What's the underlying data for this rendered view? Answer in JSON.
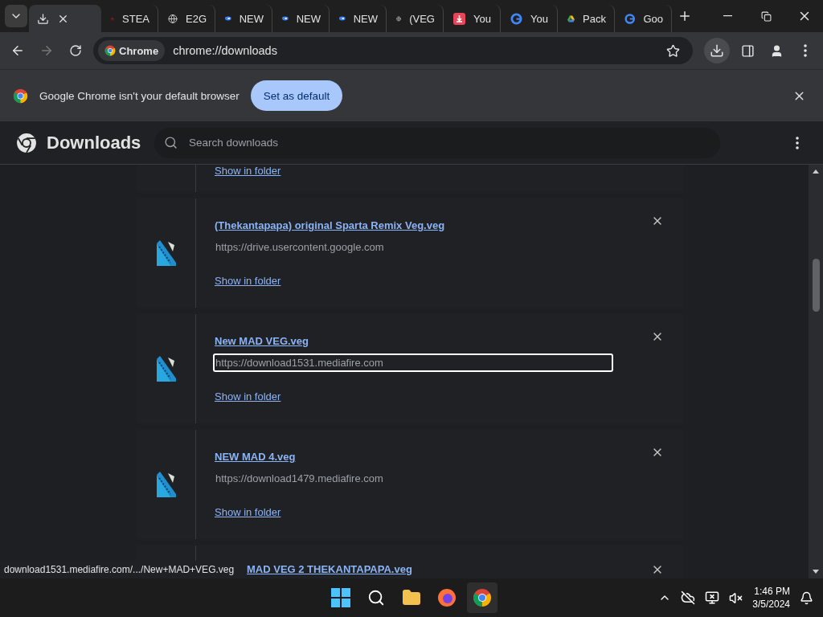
{
  "tabs": [
    {
      "selected": true
    },
    {
      "title": "STEA",
      "selected": false
    },
    {
      "title": "E2G",
      "selected": false
    },
    {
      "title": "NEW",
      "selected": false
    },
    {
      "title": "NEW",
      "selected": false
    },
    {
      "title": "NEW",
      "selected": false
    },
    {
      "title": "(VEG",
      "selected": false
    },
    {
      "title": "You",
      "selected": false
    },
    {
      "title": "You",
      "selected": false
    },
    {
      "title": "Pack",
      "selected": false
    },
    {
      "title": "Goo",
      "selected": false
    }
  ],
  "toolbar": {
    "chip": "Chrome",
    "url": "chrome://downloads"
  },
  "infobar": {
    "message": "Google Chrome isn't your default browser",
    "button": "Set as default"
  },
  "header": {
    "title": "Downloads",
    "search_placeholder": "Search downloads"
  },
  "downloads": [
    {
      "kind": "tail",
      "link": "Show in folder"
    },
    {
      "kind": "full",
      "name": "(Thekantapapa) original Sparta Remix Veg.veg",
      "url": "https://drive.usercontent.google.com",
      "link": "Show in folder",
      "focused": false
    },
    {
      "kind": "full",
      "name": "New MAD VEG.veg",
      "url": "https://download1531.mediafire.com",
      "link": "Show in folder",
      "focused": true
    },
    {
      "kind": "full",
      "name": "NEW MAD 4.veg",
      "url": "https://download1479.mediafire.com",
      "link": "Show in folder",
      "focused": false
    },
    {
      "kind": "head",
      "name": "MAD VEG 2 THEKANTAPAPA.veg"
    }
  ],
  "status_bubble": "download1531.mediafire.com/.../New+MAD+VEG.veg",
  "taskbar": {
    "time": "1:46 PM",
    "date": "3/5/2024"
  }
}
